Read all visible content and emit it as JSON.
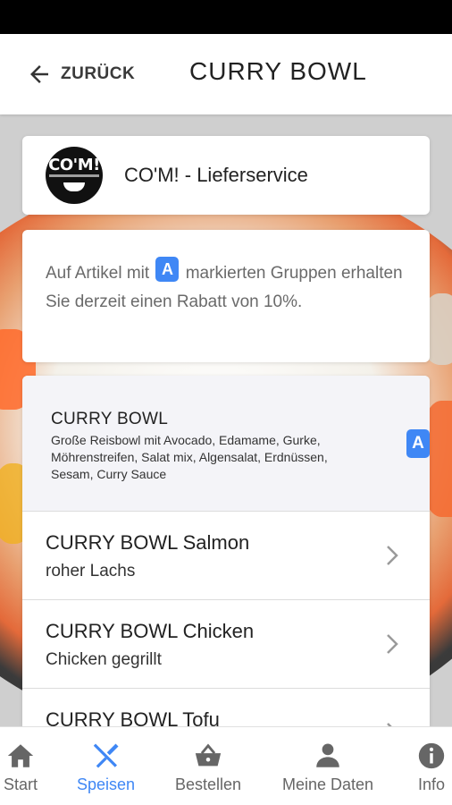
{
  "header": {
    "back_label": "ZURÜCK",
    "title": "CURRY BOWL"
  },
  "vendor": {
    "logo_text": "CO'M!",
    "name": "CO'M! - Lieferservice"
  },
  "discount": {
    "text_before": "Auf Artikel mit",
    "badge": "A",
    "text_after": "markierten Gruppen erhalten Sie derzeit einen Rabatt von 10%."
  },
  "group": {
    "title": "CURRY BOWL",
    "description": "Große Reisbowl mit Avocado, Edamame, Gurke, Möhrenstreifen, Salat mix, Algensalat, Erdnüssen, Sesam, Curry Sauce",
    "badge": "A"
  },
  "items": [
    {
      "name": "CURRY BOWL Salmon",
      "subtitle": "roher Lachs"
    },
    {
      "name": "CURRY BOWL Chicken",
      "subtitle": "Chicken gegrillt"
    },
    {
      "name": "CURRY BOWL Tofu",
      "subtitle": ""
    }
  ],
  "nav": {
    "start": "Start",
    "speisen": "Speisen",
    "bestellen": "Bestellen",
    "meine_daten": "Meine Daten",
    "info": "Info"
  },
  "colors": {
    "accent": "#3f87f5",
    "nav_inactive": "#666666",
    "statusbar": "#000000"
  }
}
